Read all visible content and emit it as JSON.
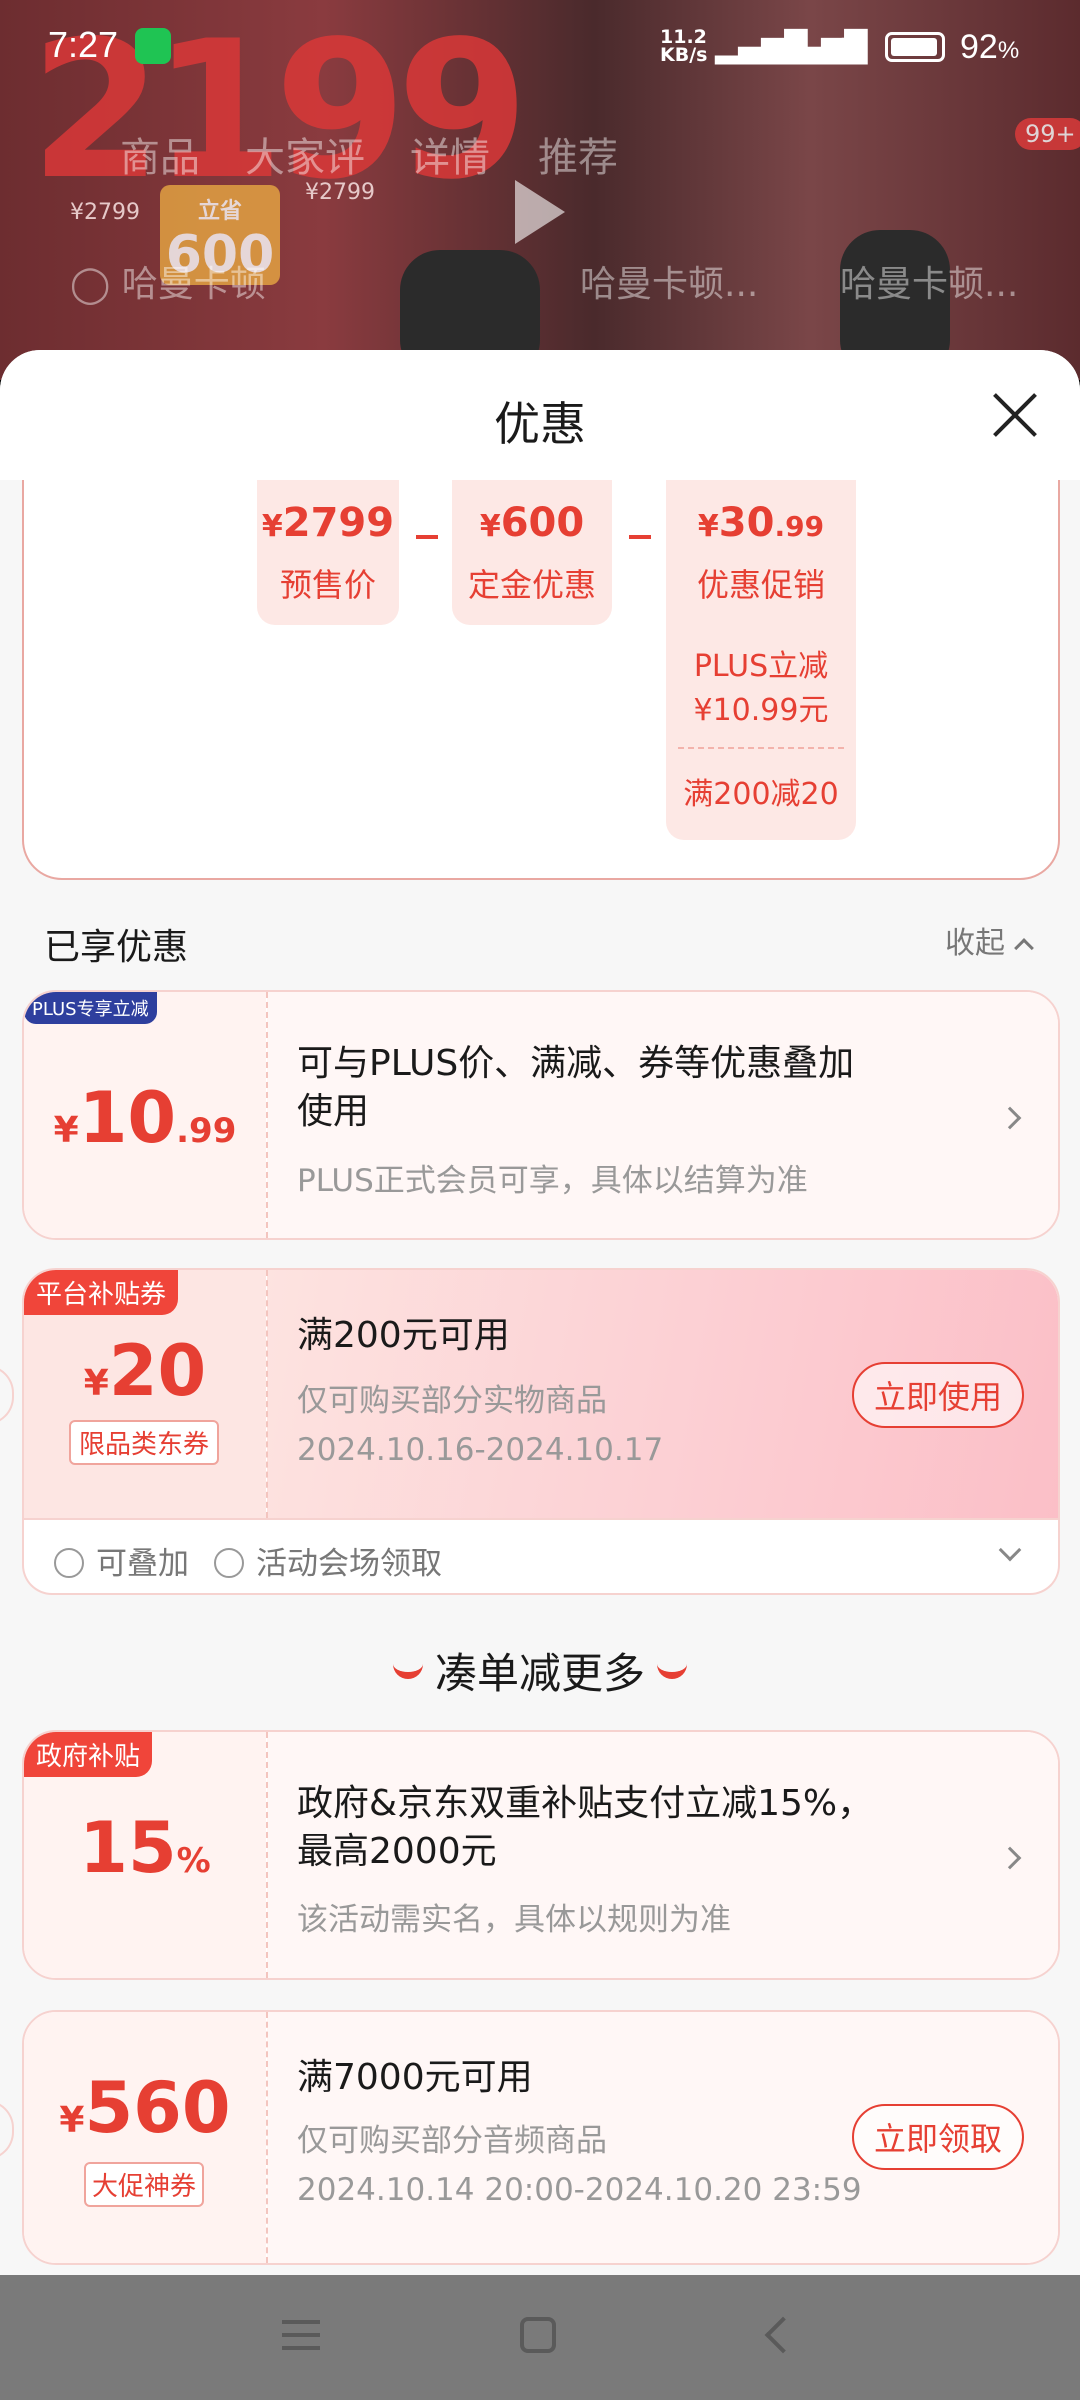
{
  "status_bar": {
    "time": "7:27",
    "net_speed": "11.2",
    "net_unit": "KB/s",
    "battery": "92",
    "battery_unit": "%"
  },
  "background": {
    "price": "2199",
    "save_label": "立省",
    "save_amount": "600",
    "old_price_1": "¥2799",
    "old_price_2": "¥2799",
    "tabs": [
      "商品",
      "大家评",
      "详情",
      "推荐"
    ],
    "badge": "99+",
    "search_items": [
      "哈曼卡顿",
      "哈曼卡顿...",
      "哈曼卡顿..."
    ]
  },
  "sheet": {
    "title": "优惠"
  },
  "calc": {
    "presale": {
      "amount": "2799",
      "label": "预售价"
    },
    "deposit": {
      "amount": "600",
      "label": "定金优惠"
    },
    "promo": {
      "amount": "30",
      "decimal": ".99",
      "label": "优惠促销"
    },
    "promo_items": [
      "PLUS立减",
      "¥10.99元",
      "满200减20"
    ],
    "currency": "¥"
  },
  "enjoyed": {
    "title": "已享优惠",
    "collapse": "收起"
  },
  "cards": [
    {
      "tag": "PLUS专享立减",
      "currency": "¥",
      "amount": "10",
      "decimal": ".99",
      "title_line1": "可与PLUS价、满减、券等优惠叠加",
      "title_line2": "使用",
      "desc": "PLUS正式会员可享，具体以结算为准"
    },
    {
      "tag": "平台补贴券",
      "currency": "¥",
      "amount": "20",
      "sub_tag": "限品类东券",
      "title": "满200元可用",
      "desc": "仅可购买部分实物商品",
      "date": "2024.10.16-2024.10.17",
      "button": "立即使用"
    },
    {
      "tag": "政府补贴",
      "amount": "15",
      "unit": "%",
      "title_line1": "政府&京东双重补贴支付立减15%，",
      "title_line2": "最高2000元",
      "desc": "该活动需实名，具体以规则为准"
    },
    {
      "currency": "¥",
      "amount": "560",
      "sub_tag": "大促神券",
      "title": "满7000元可用",
      "desc": "仅可购买部分音频商品",
      "date": "2024.10.14 20:00-2024.10.20 23:59",
      "button": "立即领取"
    }
  ],
  "foot": {
    "stackable": "可叠加",
    "source": "活动会场领取"
  },
  "more": {
    "title": "凑单减更多"
  },
  "colors": {
    "accent": "#e63f33",
    "plus_blue": "#2e3f9e",
    "tag_red": "#f0453a"
  }
}
